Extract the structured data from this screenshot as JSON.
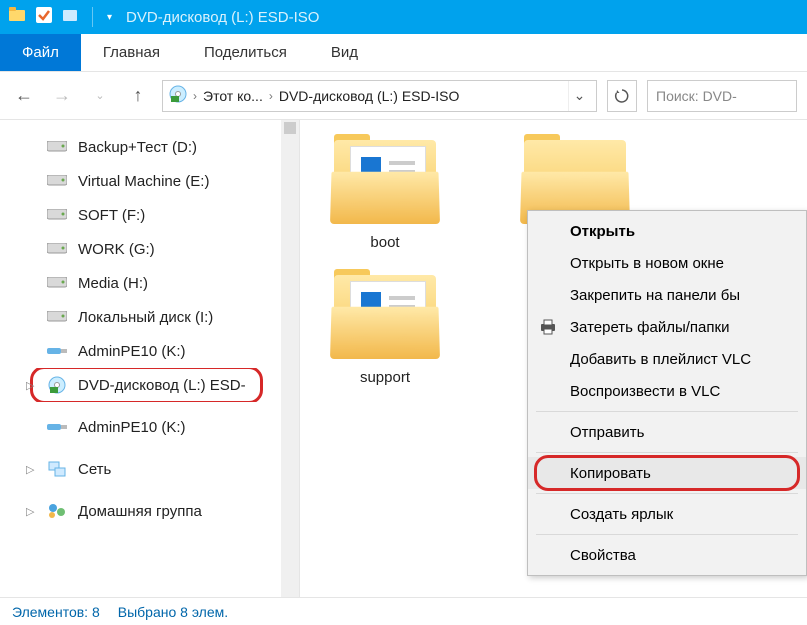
{
  "titlebar": {
    "title": "DVD-дисковод (L:) ESD-ISO"
  },
  "ribbon": {
    "file": "Файл",
    "home": "Главная",
    "share": "Поделиться",
    "view": "Вид"
  },
  "breadcrumb": {
    "root": "Этот ко...",
    "current": "DVD-дисковод (L:) ESD-ISO"
  },
  "search": {
    "placeholder": "Поиск: DVD-"
  },
  "sidebar": {
    "items": [
      {
        "label": "Backup+Тест (D:)",
        "icon": "drive"
      },
      {
        "label": "Virtual Machine (E:)",
        "icon": "drive"
      },
      {
        "label": "SOFT (F:)",
        "icon": "drive"
      },
      {
        "label": "WORK (G:)",
        "icon": "drive"
      },
      {
        "label": "Media (H:)",
        "icon": "drive"
      },
      {
        "label": "Локальный диск (I:)",
        "icon": "drive"
      },
      {
        "label": "AdminPE10 (K:)",
        "icon": "usb"
      },
      {
        "label": "DVD-дисковод (L:) ESD-",
        "icon": "disc",
        "selected": true,
        "expander": true
      },
      {
        "label": "AdminPE10 (K:)",
        "icon": "usb"
      },
      {
        "label": "Сеть",
        "icon": "net",
        "expander": true
      },
      {
        "label": "Домашняя группа",
        "icon": "group",
        "expander": true
      }
    ]
  },
  "content": {
    "items": [
      {
        "label": "boot",
        "type": "folder-doc"
      },
      {
        "label": "",
        "type": "folder-plain"
      },
      {
        "label": "support",
        "type": "folder-doc"
      },
      {
        "label": "",
        "type": "file"
      }
    ]
  },
  "context_menu": {
    "items": [
      {
        "label": "Открыть",
        "bold": true
      },
      {
        "label": "Открыть в новом окне"
      },
      {
        "label": "Закрепить на панели бы"
      },
      {
        "label": "Затереть файлы/папки",
        "icon": "printer"
      },
      {
        "label": "Добавить в плейлист VLC"
      },
      {
        "label": "Воспроизвести в VLC"
      },
      {
        "sep": true
      },
      {
        "label": "Отправить"
      },
      {
        "sep": true
      },
      {
        "label": "Копировать",
        "highlighted": true
      },
      {
        "sep": true
      },
      {
        "label": "Создать ярлык"
      },
      {
        "sep": true
      },
      {
        "label": "Свойства"
      }
    ]
  },
  "statusbar": {
    "count_label": "Элементов: 8",
    "selection_label": "Выбрано 8 элем."
  }
}
